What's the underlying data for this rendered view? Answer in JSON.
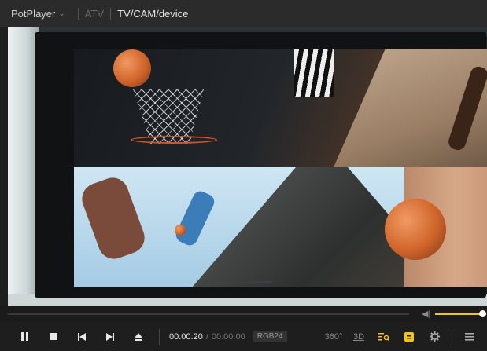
{
  "titlebar": {
    "app_name": "PotPlayer",
    "dropdown_chevron": "chevron-down-icon",
    "tab_atv": "ATV",
    "source": "TV/CAM/device"
  },
  "player": {
    "volume_level": 1.0,
    "volume_icon": "speaker-icon"
  },
  "controls": {
    "pause": "pause-icon",
    "stop": "stop-icon",
    "prev": "previous-icon",
    "next": "next-icon",
    "eject": "eject-icon",
    "current_time": "00:00:20",
    "time_separator": "/",
    "duration": "00:00:00",
    "format": "RGB24",
    "vr_label": "360°",
    "threed_label": "3D",
    "playlist": "playlist-search-icon",
    "subtitle": "subtitle-icon",
    "settings": "gear-icon",
    "menu": "hamburger-menu-icon"
  },
  "colors": {
    "accent": "#f0c419",
    "titlebar_bg": "#2b2b2b",
    "controls_bg": "#1e1e1e"
  }
}
